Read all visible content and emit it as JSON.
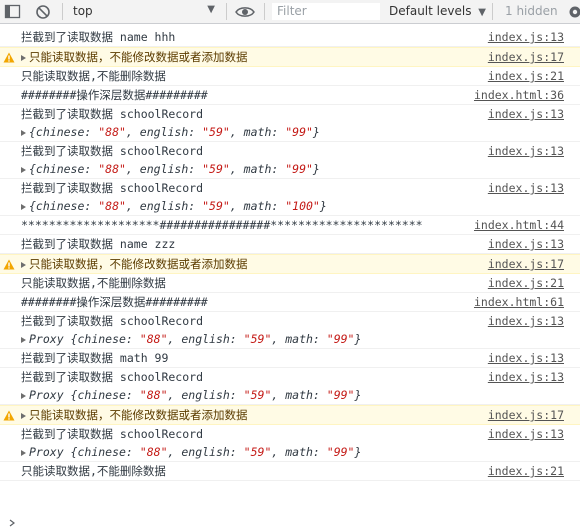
{
  "toolbar": {
    "context": "top",
    "filter_placeholder": "Filter",
    "levels": "Default levels",
    "hidden": "1 hidden"
  },
  "messages": [
    {
      "type": "log",
      "text": "拦截到了读取数据 name hhh",
      "source": "index.js:13"
    },
    {
      "type": "warn",
      "text": "只能读取数据，不能修改数据或者添加数据",
      "source": "index.js:17"
    },
    {
      "type": "log",
      "text": "只能读取数据,不能删除数据",
      "source": "index.js:21"
    },
    {
      "type": "log",
      "text": "########操作深层数据#########",
      "source": "index.html:36"
    },
    {
      "type": "log",
      "text": "拦截到了读取数据 schoolRecord",
      "source": "index.js:13",
      "object": {
        "prefix": "",
        "chinese": "\"88\"",
        "english": "\"59\"",
        "math": "\"99\""
      }
    },
    {
      "type": "log",
      "text": "拦截到了读取数据 schoolRecord",
      "source": "index.js:13",
      "object": {
        "prefix": "",
        "chinese": "\"88\"",
        "english": "\"59\"",
        "math": "\"99\""
      }
    },
    {
      "type": "log",
      "text": "拦截到了读取数据 schoolRecord",
      "source": "index.js:13",
      "object": {
        "prefix": "",
        "chinese": "\"88\"",
        "english": "\"59\"",
        "math": "\"100\""
      }
    },
    {
      "type": "log",
      "text": "********************################**********************",
      "source": "index.html:44"
    },
    {
      "type": "log",
      "text": "拦截到了读取数据 name zzz",
      "source": "index.js:13"
    },
    {
      "type": "warn",
      "text": "只能读取数据，不能修改数据或者添加数据",
      "source": "index.js:17"
    },
    {
      "type": "log",
      "text": "只能读取数据,不能删除数据",
      "source": "index.js:21"
    },
    {
      "type": "log",
      "text": "########操作深层数据#########",
      "source": "index.html:61"
    },
    {
      "type": "log",
      "text": "拦截到了读取数据 schoolRecord",
      "source": "index.js:13",
      "object": {
        "prefix": "Proxy ",
        "chinese": "\"88\"",
        "english": "\"59\"",
        "math": "\"99\""
      }
    },
    {
      "type": "log",
      "text": "拦截到了读取数据 math 99",
      "source": "index.js:13"
    },
    {
      "type": "log",
      "text": "拦截到了读取数据 schoolRecord",
      "source": "index.js:13",
      "object": {
        "prefix": "Proxy ",
        "chinese": "\"88\"",
        "english": "\"59\"",
        "math": "\"99\""
      }
    },
    {
      "type": "warn",
      "text": "只能读取数据，不能修改数据或者添加数据",
      "source": "index.js:17"
    },
    {
      "type": "log",
      "text": "拦截到了读取数据 schoolRecord",
      "source": "index.js:13",
      "object": {
        "prefix": "Proxy ",
        "chinese": "\"88\"",
        "english": "\"59\"",
        "math": "\"99\""
      }
    },
    {
      "type": "log",
      "text": "只能读取数据,不能删除数据",
      "source": "index.js:21"
    }
  ]
}
